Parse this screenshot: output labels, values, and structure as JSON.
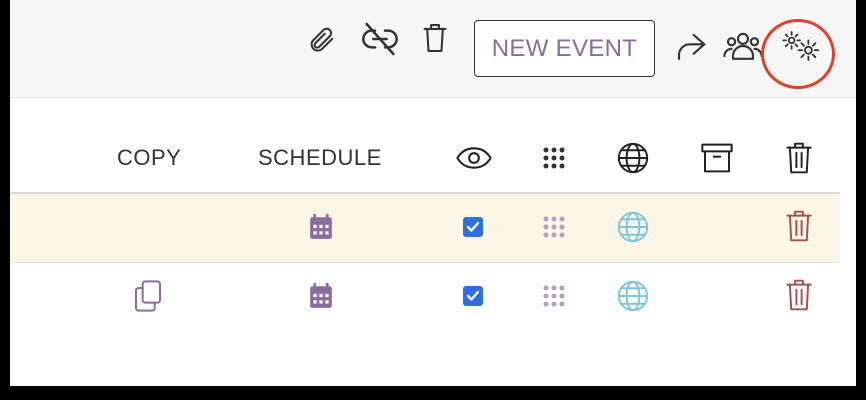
{
  "toolbar": {
    "new_event_label": "NEW EVENT",
    "icons": [
      "paperclip-icon",
      "unlink-icon",
      "trash-icon",
      "share-icon",
      "users-icon",
      "settings-icon"
    ]
  },
  "table": {
    "columns": [
      "COPY",
      "SCHEDULE",
      "eye-icon",
      "dots-grid-icon",
      "globe-icon",
      "archive-icon",
      "trash-icon"
    ],
    "rows": [
      {
        "copy": false,
        "schedule": true,
        "visible": true,
        "grid": true,
        "globe": true,
        "delete": true
      },
      {
        "copy": true,
        "schedule": true,
        "visible": true,
        "grid": true,
        "globe": true,
        "delete": true
      }
    ]
  },
  "colors": {
    "accent_purple": "#8a6d9f",
    "highlight_red": "#e0412b",
    "checkbox_blue": "#2e6fdf",
    "globe_blue": "#7ec6dc",
    "delete_red": "#a4524a",
    "row_highlight": "#fcf6e6"
  }
}
